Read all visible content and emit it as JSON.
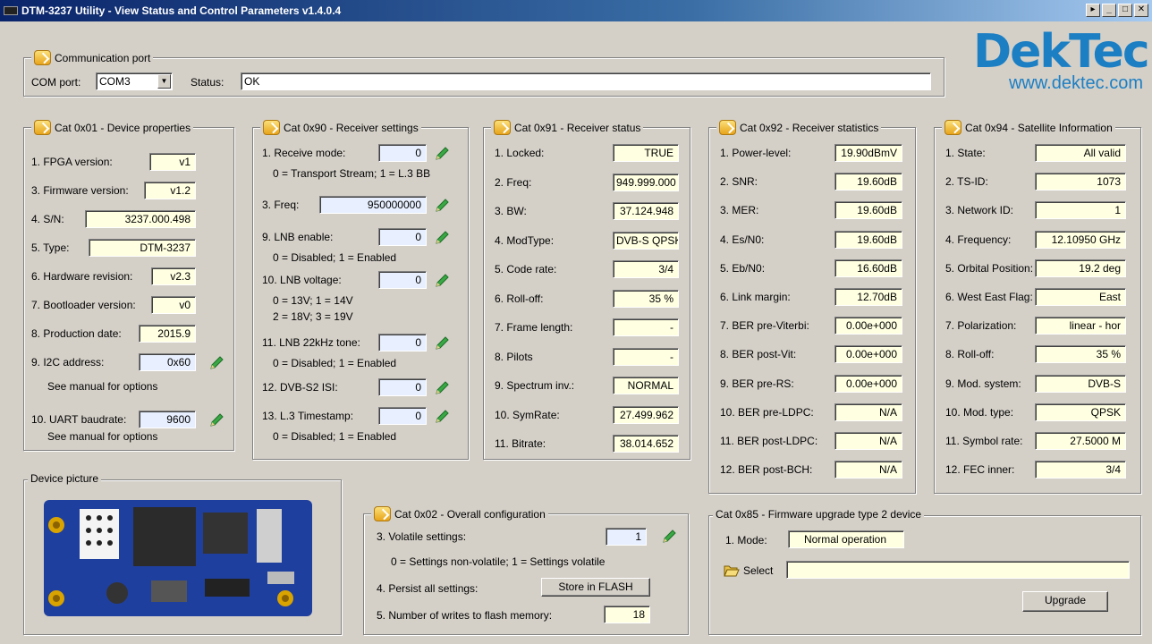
{
  "window": {
    "title": "DTM-3237 Utility - View Status and Control Parameters v1.4.0.4",
    "buttons": [
      "▸",
      "_",
      "□",
      "✕"
    ]
  },
  "logo": {
    "brand": "DekTec",
    "url": "www.dektec.com"
  },
  "comm": {
    "legend": "Communication port",
    "com_label": "COM port:",
    "com_value": "COM3",
    "status_label": "Status:",
    "status_value": "OK"
  },
  "cat01": {
    "legend": "Cat 0x01 - Device properties",
    "rows": [
      {
        "label": "1. FPGA version:",
        "value": "v1"
      },
      {
        "label": "3. Firmware version:",
        "value": "v1.2"
      },
      {
        "label": "4. S/N:",
        "value": "3237.000.498"
      },
      {
        "label": "5. Type:",
        "value": "DTM-3237"
      },
      {
        "label": "6. Hardware revision:",
        "value": "v2.3"
      },
      {
        "label": "7. Bootloader version:",
        "value": "v0"
      },
      {
        "label": "8. Production date:",
        "value": "2015.9"
      },
      {
        "label": "9. I2C address:",
        "value": "0x60"
      },
      {
        "label": "10. UART baudrate:",
        "value": "9600"
      }
    ],
    "hint_i2c": "See manual for options",
    "hint_uart": "See manual for options"
  },
  "cat90": {
    "legend": "Cat 0x90 - Receiver settings",
    "rows": [
      {
        "label": "1. Receive mode:",
        "value": "0",
        "hint": "0 = Transport Stream; 1 = L.3 BB"
      },
      {
        "label": "3. Freq:",
        "value": "950000000"
      },
      {
        "label": "9. LNB enable:",
        "value": "0",
        "hint": "0 = Disabled; 1 = Enabled"
      },
      {
        "label": "10. LNB voltage:",
        "value": "0",
        "hint": "0 = 13V; 1 = 14V",
        "hint2": "2 = 18V; 3 = 19V"
      },
      {
        "label": "11. LNB 22kHz tone:",
        "value": "0",
        "hint": "0 = Disabled; 1 = Enabled"
      },
      {
        "label": "12. DVB-S2 ISI:",
        "value": "0"
      },
      {
        "label": "13. L.3 Timestamp:",
        "value": "0",
        "hint": "0 = Disabled; 1 = Enabled"
      }
    ]
  },
  "cat91": {
    "legend": "Cat 0x91 - Receiver status",
    "rows": [
      {
        "label": "1. Locked:",
        "value": "TRUE"
      },
      {
        "label": "2. Freq:",
        "value": "949.999.000"
      },
      {
        "label": "3. BW:",
        "value": "37.124.948"
      },
      {
        "label": "4. ModType:",
        "value": "DVB-S QPSK"
      },
      {
        "label": "5. Code rate:",
        "value": "3/4"
      },
      {
        "label": "6. Roll-off:",
        "value": "35 %"
      },
      {
        "label": "7. Frame length:",
        "value": "-"
      },
      {
        "label": "8. Pilots",
        "value": "-"
      },
      {
        "label": "9. Spectrum inv.:",
        "value": "NORMAL"
      },
      {
        "label": "10. SymRate:",
        "value": "27.499.962"
      },
      {
        "label": "11. Bitrate:",
        "value": "38.014.652"
      }
    ]
  },
  "cat92": {
    "legend": "Cat 0x92 - Receiver statistics",
    "rows": [
      {
        "label": "1. Power-level:",
        "value": "19.90dBmV"
      },
      {
        "label": "2. SNR:",
        "value": "19.60dB"
      },
      {
        "label": "3. MER:",
        "value": "19.60dB"
      },
      {
        "label": "4. Es/N0:",
        "value": "19.60dB"
      },
      {
        "label": "5. Eb/N0:",
        "value": "16.60dB"
      },
      {
        "label": "6. Link margin:",
        "value": "12.70dB"
      },
      {
        "label": "7. BER pre-Viterbi:",
        "value": "0.00e+000"
      },
      {
        "label": "8. BER post-Vit:",
        "value": "0.00e+000"
      },
      {
        "label": "9. BER pre-RS:",
        "value": "0.00e+000"
      },
      {
        "label": "10. BER pre-LDPC:",
        "value": "N/A"
      },
      {
        "label": "11. BER post-LDPC:",
        "value": "N/A"
      },
      {
        "label": "12. BER post-BCH:",
        "value": "N/A"
      }
    ]
  },
  "cat94": {
    "legend": "Cat 0x94 - Satellite Information",
    "rows": [
      {
        "label": "1. State:",
        "value": "All valid"
      },
      {
        "label": "2. TS-ID:",
        "value": "1073"
      },
      {
        "label": "3. Network ID:",
        "value": "1"
      },
      {
        "label": "4. Frequency:",
        "value": "12.10950 GHz"
      },
      {
        "label": "5. Orbital Position:",
        "value": "19.2 deg"
      },
      {
        "label": "6. West East Flag:",
        "value": "East"
      },
      {
        "label": "7. Polarization:",
        "value": "linear - hor"
      },
      {
        "label": "8. Roll-off:",
        "value": "35 %"
      },
      {
        "label": "9. Mod. system:",
        "value": "DVB-S"
      },
      {
        "label": "10. Mod. type:",
        "value": "QPSK"
      },
      {
        "label": "11. Symbol rate:",
        "value": "27.5000 M"
      },
      {
        "label": "12. FEC inner:",
        "value": "3/4"
      }
    ]
  },
  "picture": {
    "legend": "Device picture"
  },
  "cat02": {
    "legend": "Cat 0x02 - Overall configuration",
    "volatile_label": "3. Volatile settings:",
    "volatile_value": "1",
    "volatile_hint": "0 = Settings non-volatile; 1 = Settings volatile",
    "persist_label": "4. Persist all settings:",
    "persist_button": "Store in FLASH",
    "writes_label": "5. Number of writes to flash memory:",
    "writes_value": "18"
  },
  "cat85": {
    "legend": "Cat 0x85 - Firmware upgrade type 2 device",
    "mode_label": "1. Mode:",
    "mode_value": "Normal operation",
    "select_label": "Select",
    "select_value": "",
    "upgrade_button": "Upgrade"
  },
  "colors": {
    "accent": "#1c7fc4",
    "value_bg": "#ffffe1",
    "window_bg": "#d4d0c8"
  }
}
